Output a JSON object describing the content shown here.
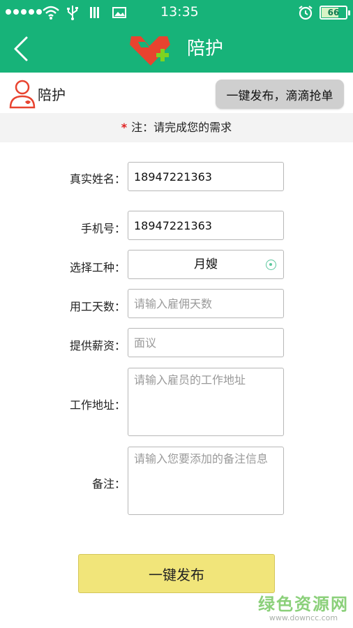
{
  "status_bar": {
    "time": "13:35",
    "battery": "66",
    "battery_level": 0.66
  },
  "header": {
    "title": "陪护",
    "back_icon": "chevron-left-icon",
    "logo_icon": "heart-plus-logo-icon"
  },
  "subheader": {
    "label": "陪护",
    "publish_label": "一键发布，滴滴抢单",
    "user_icon": "nurse-user-icon"
  },
  "notice": {
    "star": "*",
    "text": "注：请完成您的需求"
  },
  "form": {
    "name": {
      "label": "真实姓名：",
      "value": "18947221363",
      "placeholder": ""
    },
    "phone": {
      "label": "手机号：",
      "value": "18947221363",
      "placeholder": ""
    },
    "job_type": {
      "label": "选择工种：",
      "value": "月嫂"
    },
    "days": {
      "label": "用工天数：",
      "value": "",
      "placeholder": "请输入雇佣天数"
    },
    "salary": {
      "label": "提供薪资：",
      "value": "",
      "placeholder": "面议"
    },
    "address": {
      "label": "工作地址：",
      "value": "",
      "placeholder": "请输入雇员的工作地址"
    },
    "remark": {
      "label": "备注：",
      "value": "",
      "placeholder": "请输入您要添加的备注信息"
    }
  },
  "publish_button": "一键发布",
  "watermark": {
    "main": "绿色资源网",
    "sub": "www.downcc.com"
  },
  "colors": {
    "primary": "#17b379",
    "button_yellow": "#f1e57a",
    "logo_red": "#e8432f",
    "logo_green": "#7ed321"
  }
}
